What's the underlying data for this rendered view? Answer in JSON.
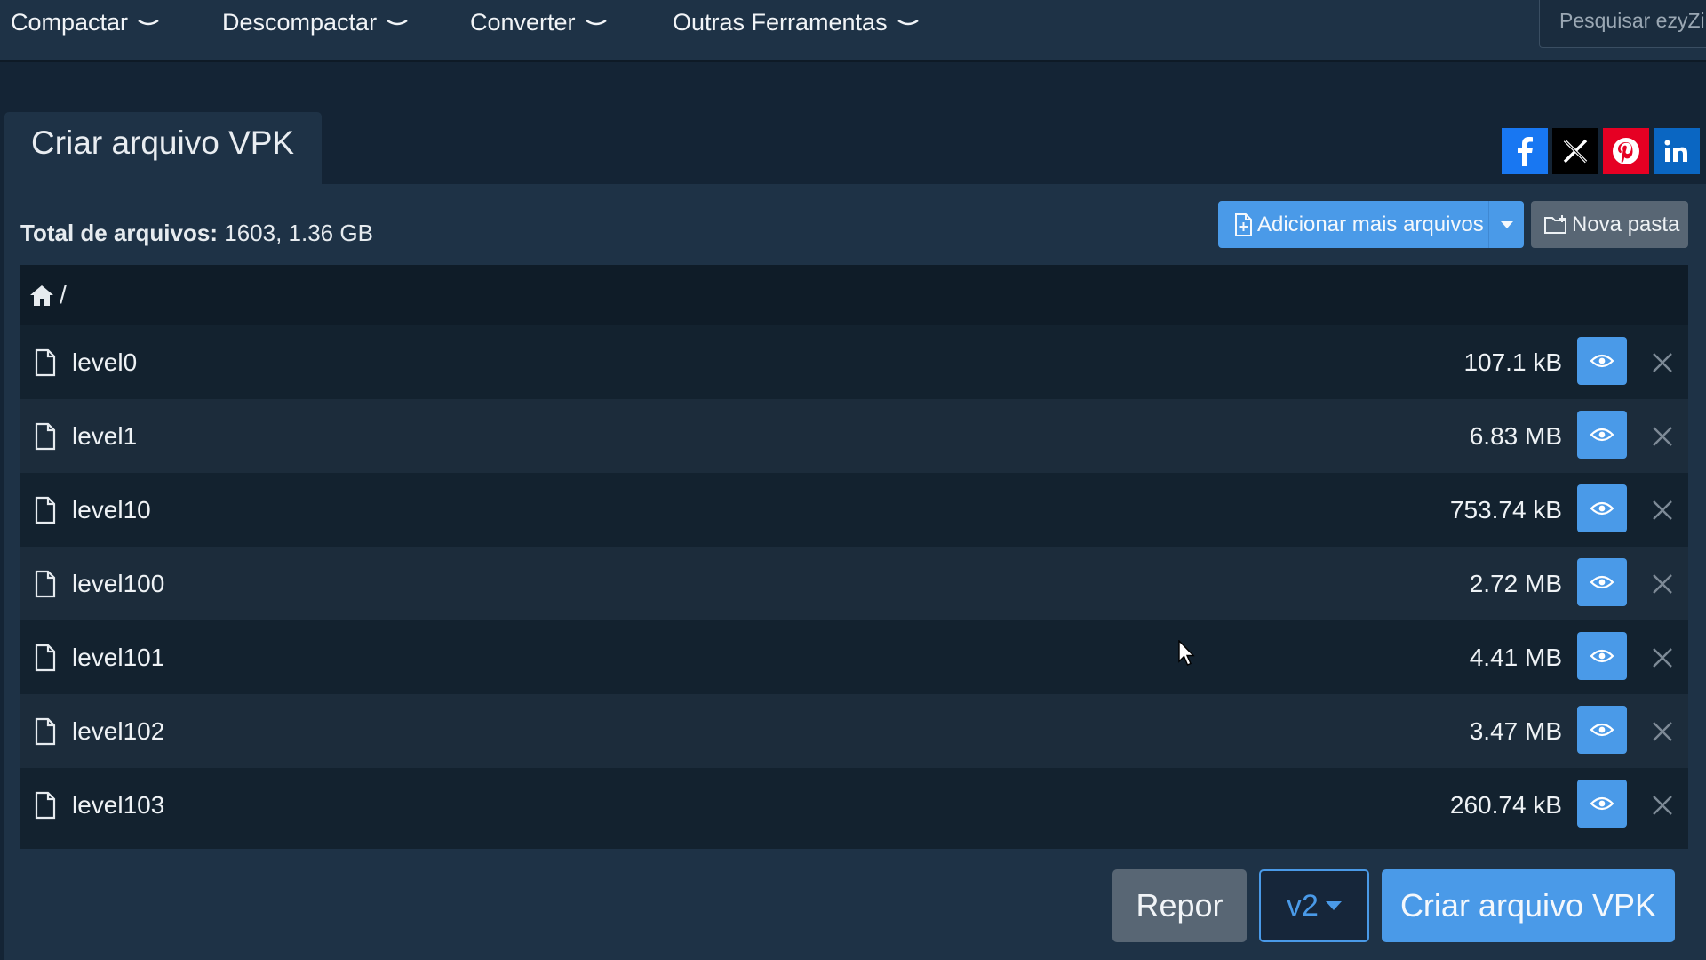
{
  "nav": {
    "items": [
      {
        "label": "Compactar"
      },
      {
        "label": "Descompactar"
      },
      {
        "label": "Converter"
      },
      {
        "label": "Outras Ferramentas"
      }
    ],
    "search_placeholder": "Pesquisar ezyZip"
  },
  "tab": {
    "title": "Criar arquivo VPK"
  },
  "social": [
    {
      "icon": "facebook-icon",
      "glyph": "f",
      "color": "#1877f2"
    },
    {
      "icon": "x-icon",
      "glyph": "𝕏",
      "color": "#000000"
    },
    {
      "icon": "pinterest-icon",
      "glyph": "P",
      "color": "#e60023"
    },
    {
      "icon": "linkedin-icon",
      "glyph": "in",
      "color": "#0a66c2"
    }
  ],
  "summary": {
    "label": "Total de arquivos:",
    "value": "1603, 1.36 GB"
  },
  "toolbar": {
    "add_label": "Adicionar mais arquivos",
    "folder_label": "Nova pasta"
  },
  "breadcrumb": {
    "separator": "/"
  },
  "files": [
    {
      "name": "level0",
      "size": "107.1 kB"
    },
    {
      "name": "level1",
      "size": "6.83 MB"
    },
    {
      "name": "level10",
      "size": "753.74 kB"
    },
    {
      "name": "level100",
      "size": "2.72 MB"
    },
    {
      "name": "level101",
      "size": "4.41 MB"
    },
    {
      "name": "level102",
      "size": "3.47 MB"
    },
    {
      "name": "level103",
      "size": "260.74 kB"
    }
  ],
  "footer": {
    "reset_label": "Repor",
    "version_label": "v2",
    "create_label": "Criar arquivo VPK"
  },
  "colors": {
    "accent": "#4a9ae8",
    "panel": "#1e3246",
    "background": "#142435"
  }
}
